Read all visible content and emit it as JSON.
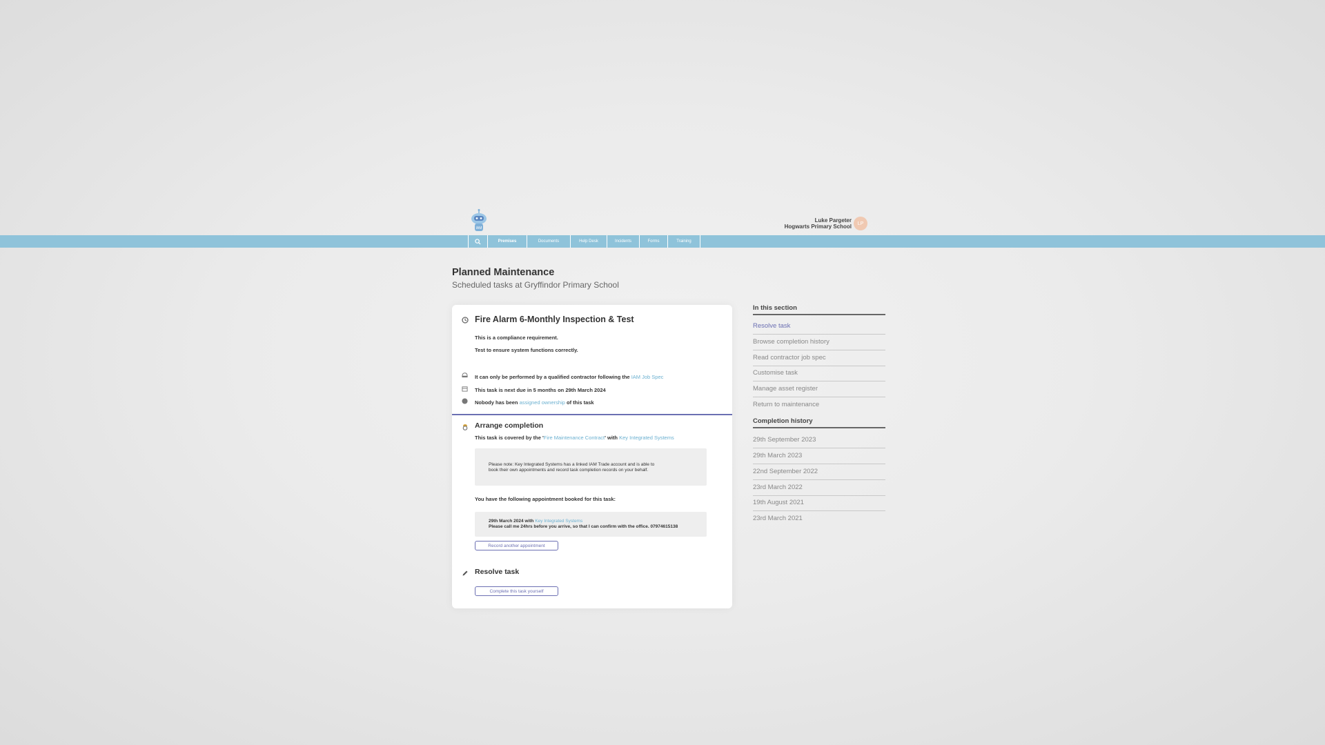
{
  "header": {
    "nav_items": [
      "Premises",
      "Documents",
      "Help Desk",
      "Incidents",
      "Forms",
      "Training"
    ],
    "user_name": "Luke Pargeter",
    "user_school": "Hogwarts Primary School",
    "user_initials": "LP",
    "accent_color": "#8fc3da"
  },
  "page": {
    "title": "Planned Maintenance",
    "subtitle": "Scheduled tasks at Gryffindor Primary School"
  },
  "task": {
    "title": "Fire Alarm 6-Monthly Inspection & Test",
    "compliance": "This is a compliance requirement.",
    "description": "Test to ensure system functions correctly.",
    "contractor_text": "It can only be performed by a qualified contractor following the",
    "contractor_link": "IAM Job Spec",
    "due_prefix": "This task is next due in",
    "due_bold": "5 months",
    "due_mid": "on",
    "due_date": "29th March 2024",
    "owner_prefix": "Nobody has been",
    "owner_link": "assigned ownership",
    "owner_suffix": "of this task"
  },
  "arrange": {
    "title": "Arrange completion",
    "covered_prefix": "This task is covered by the '",
    "contract_link": "Fire Maintenance Contract",
    "covered_mid": "' with",
    "supplier_link": "Key Integrated Systems",
    "note_line1": "Please note: Key Integrated Systems has a linked IAM Trade account and is able to",
    "note_line2": "book their own appointments and record task completion records on your behalf.",
    "appointments_heading": "You have the following appointment booked for this task:",
    "appt_date": "29th March 2024",
    "appt_with": "with",
    "appt_supplier": "Key Integrated Systems",
    "appt_note": "Please call me 24hrs before you arrive, so that I can confirm with the office. 07974615138",
    "record_button": "Record another appointment"
  },
  "resolve": {
    "title": "Resolve task",
    "complete_button": "Complete this task yourself"
  },
  "sidebar": {
    "section_title": "In this section",
    "items": [
      {
        "label": "Resolve task",
        "active": true
      },
      {
        "label": "Browse completion history",
        "active": false
      },
      {
        "label": "Read contractor job spec",
        "active": false
      },
      {
        "label": "Customise task",
        "active": false
      },
      {
        "label": "Manage asset register",
        "active": false
      },
      {
        "label": "Return to maintenance",
        "active": false
      }
    ],
    "history_title": "Completion history",
    "history": [
      "29th September 2023",
      "29th March 2023",
      "22nd September 2022",
      "23rd March 2022",
      "19th August 2021",
      "23rd March 2021"
    ]
  },
  "colors": {
    "active_link": "#6b6fb2",
    "link": "#6bb0d0",
    "divider": "#6b6fb2"
  }
}
